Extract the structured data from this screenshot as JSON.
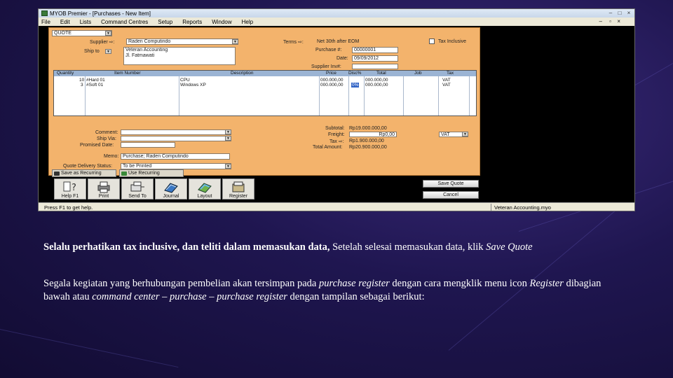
{
  "window": {
    "title": "MYOB Premier - [Purchases - New Item]",
    "menu": [
      "File",
      "Edit",
      "Lists",
      "Command Centres",
      "Setup",
      "Reports",
      "Window",
      "Help"
    ]
  },
  "form": {
    "type_value": "QUOTE",
    "supplier_label": "Supplier ⇨:",
    "supplier_value": "Raden Computindo",
    "terms_label": "Terms ⇨:",
    "terms_value": "Net 30th after EOM",
    "tax_inclusive_label": "Tax Inclusive",
    "ship_to_label": "Ship to",
    "ship_to_line1": "Veteran Accounting",
    "ship_to_line2": "Jl. Fatmawati",
    "purchase_no_label": "Purchase #:",
    "purchase_no_value": "00000001",
    "date_label": "Date:",
    "date_value": "09/09/2012",
    "supplier_inv_label": "Supplier Inv#:",
    "supplier_inv_value": "",
    "columns": [
      "Quantity",
      "Item Number",
      "Description",
      "Price",
      "Disc%",
      "Total",
      "Job",
      "Tax"
    ],
    "rows": [
      {
        "quantity": "10",
        "item": "#Hard 01",
        "description": "CPU",
        "price": "000.000,00",
        "disc": "",
        "total": "000.000,00",
        "job": "",
        "tax": "VAT"
      },
      {
        "quantity": "3",
        "item": "#Soft 01",
        "description": "Windows XP",
        "price": "000.000,00",
        "disc": "0%",
        "total": "000.000,00",
        "job": "",
        "tax": "VAT"
      }
    ],
    "comment_label": "Comment:",
    "ship_via_label": "Ship Via:",
    "promised_date_label": "Promised Date:",
    "memo_label": "Memo:",
    "memo_value": "Purchase; Raden Computindo",
    "quote_status_label": "Quote Delivery Status:",
    "quote_status_value": "To be Printed",
    "save_recurring_label": "Save as Recurring",
    "use_recurring_label": "Use Recurring",
    "subtotal_label": "Subtotal:",
    "subtotal_value": "Rp19.000.000,00",
    "freight_label": "Freight:",
    "freight_value": "Rp0,00",
    "freight_tax": "VAT",
    "tax_label": "Tax ⇨:",
    "tax_value": "Rp1.900.000,00",
    "total_label": "Total Amount:",
    "total_value": "Rp20.900.000,00"
  },
  "toolbar": [
    {
      "label": "Help F1",
      "icon": "help-icon"
    },
    {
      "label": "Print",
      "icon": "print-icon"
    },
    {
      "label": "Send To",
      "icon": "send-icon"
    },
    {
      "label": "Journal",
      "icon": "journal-icon"
    },
    {
      "label": "Layout",
      "icon": "layout-icon"
    },
    {
      "label": "Register",
      "icon": "register-icon"
    }
  ],
  "buttons": {
    "save_quote": "Save Quote",
    "cancel": "Cancel"
  },
  "status": {
    "left": "Press F1 to get help.",
    "right": "Veteran Accounting.myo"
  },
  "text": {
    "p1_bold": "Selalu perhatikan tax inclusive, dan teliti dalam memasukan data,",
    "p1_normal": " Setelah selesai memasukan data, klik ",
    "p1_italic": "Save Quote",
    "p2_a": "Segala kegiatan yang berhubungan pembelian akan tersimpan pada ",
    "p2_b": "purchase register",
    "p2_c": " dengan cara mengklik menu icon ",
    "p2_d": "Register",
    "p2_e": " dibagian bawah atau ",
    "p2_f": "command center – purchase – purchase register",
    "p2_g": "  dengan tampilan sebagai berikut:"
  },
  "colors": {
    "form_bg": "#f3b36c",
    "grid_header": "#9bb4d4",
    "selection": "#3163c5",
    "slide_bg": "#1f1650"
  }
}
